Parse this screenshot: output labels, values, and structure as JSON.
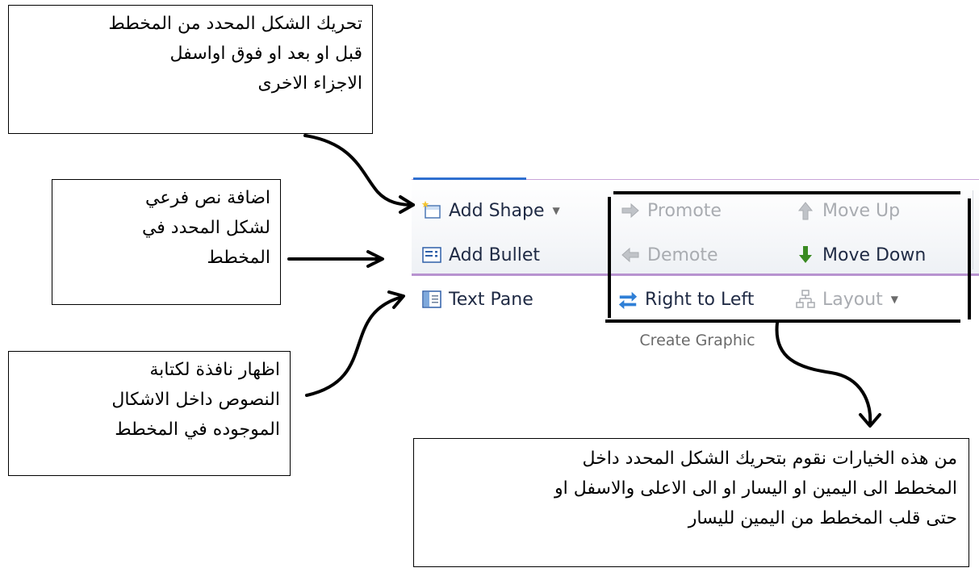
{
  "ribbon": {
    "group_label": "Create Graphic",
    "buttons": {
      "add_shape": "Add Shape",
      "add_bullet": "Add Bullet",
      "text_pane": "Text Pane",
      "promote": "Promote",
      "demote": "Demote",
      "right_to_left": "Right to Left",
      "move_up": "Move Up",
      "move_down": "Move Down",
      "layout": "Layout"
    },
    "icons": {
      "add_shape": "add-shape-icon",
      "add_bullet": "add-bullet-icon",
      "text_pane": "text-pane-icon",
      "promote": "arrow-right-icon",
      "demote": "arrow-left-icon",
      "right_to_left": "swap-arrows-icon",
      "move_up": "arrow-up-icon",
      "move_down": "arrow-down-icon",
      "layout": "layout-hierarchy-icon"
    },
    "colors": {
      "accent": "#2e6fd0",
      "move_down_green": "#3a8a22",
      "disabled": "#a9acb1"
    }
  },
  "callouts": {
    "move_shape": [
      "تحريك الشكل المحدد من المخطط",
      "قبل او بعد او فوق اواسفل",
      "الاجزاء الاخرى"
    ],
    "add_bullet": [
      "اضافة نص فرعي",
      "لشكل المحدد في",
      "المخطط"
    ],
    "text_pane": [
      "اظهار نافذة لكتابة",
      "النصوص داخل الاشكال",
      "الموجوده في المخطط"
    ],
    "options": [
      "من هذه الخيارات نقوم بتحريك الشكل المحدد داخل",
      "المخطط الى اليمين او اليسار او الى الاعلى والاسفل او",
      "حتى قلب المخطط من اليمين لليسار"
    ]
  }
}
